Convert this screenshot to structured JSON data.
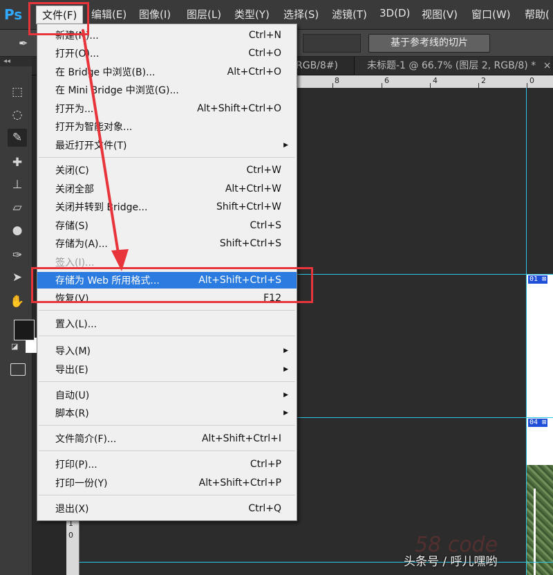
{
  "app": {
    "logo": "Ps",
    "menubar": [
      {
        "label": "文件(F)"
      },
      {
        "label": "编辑(E)"
      },
      {
        "label": "图像(I)"
      },
      {
        "label": "图层(L)"
      },
      {
        "label": "类型(Y)"
      },
      {
        "label": "选择(S)"
      },
      {
        "label": "滤镜(T)"
      },
      {
        "label": "3D(D)"
      },
      {
        "label": "视图(V)"
      },
      {
        "label": "窗口(W)"
      },
      {
        "label": "帮助("
      }
    ]
  },
  "options_bar": {
    "slice_button": "基于参考线的切片"
  },
  "toolbar": {
    "collapse": "◂◂",
    "tools": [
      {
        "icon": "marquee-icon"
      },
      {
        "icon": "lasso-icon"
      },
      {
        "icon": "slice-tool-icon"
      },
      {
        "icon": "healing-brush-icon"
      },
      {
        "icon": "clone-stamp-icon"
      },
      {
        "icon": "eraser-icon"
      },
      {
        "icon": "blur-icon"
      },
      {
        "icon": "pen-icon"
      },
      {
        "icon": "path-selection-icon"
      },
      {
        "icon": "hand-icon"
      }
    ],
    "foreground_color": "#1a1a1a",
    "background_color": "#ffffff"
  },
  "document": {
    "tabs": [
      {
        "label": "RGB/8#)"
      },
      {
        "label": "未标题-1 @ 66.7% (图层 2, RGB/8) *",
        "close": "×"
      }
    ],
    "ruler_top": [
      "8",
      "6",
      "4",
      "2",
      "0"
    ],
    "ruler_left": [
      "1",
      "0"
    ],
    "slices": [
      {
        "label": "01"
      },
      {
        "label": "04"
      }
    ]
  },
  "file_menu": {
    "groups": [
      [
        {
          "label": "新建(N)...",
          "shortcut": "Ctrl+N"
        },
        {
          "label": "打开(O)...",
          "shortcut": "Ctrl+O"
        },
        {
          "label": "在 Bridge 中浏览(B)...",
          "shortcut": "Alt+Ctrl+O"
        },
        {
          "label": "在 Mini Bridge 中浏览(G)...",
          "shortcut": ""
        },
        {
          "label": "打开为...",
          "shortcut": "Alt+Shift+Ctrl+O"
        },
        {
          "label": "打开为智能对象...",
          "shortcut": ""
        },
        {
          "label": "最近打开文件(T)",
          "shortcut": "",
          "submenu": true
        }
      ],
      [
        {
          "label": "关闭(C)",
          "shortcut": "Ctrl+W"
        },
        {
          "label": "关闭全部",
          "shortcut": "Alt+Ctrl+W"
        },
        {
          "label": "关闭并转到 Bridge...",
          "shortcut": "Shift+Ctrl+W"
        },
        {
          "label": "存储(S)",
          "shortcut": "Ctrl+S"
        },
        {
          "label": "存储为(A)...",
          "shortcut": "Shift+Ctrl+S"
        },
        {
          "label": "签入(I)...",
          "shortcut": "",
          "disabled": true
        },
        {
          "label": "存储为 Web 所用格式...",
          "shortcut": "Alt+Shift+Ctrl+S",
          "selected": true
        },
        {
          "label": "恢复(V)",
          "shortcut": "F12"
        }
      ],
      [
        {
          "label": "置入(L)...",
          "shortcut": ""
        }
      ],
      [
        {
          "label": "导入(M)",
          "shortcut": "",
          "submenu": true
        },
        {
          "label": "导出(E)",
          "shortcut": "",
          "submenu": true
        }
      ],
      [
        {
          "label": "自动(U)",
          "shortcut": "",
          "submenu": true
        },
        {
          "label": "脚本(R)",
          "shortcut": "",
          "submenu": true
        }
      ],
      [
        {
          "label": "文件简介(F)...",
          "shortcut": "Alt+Shift+Ctrl+I"
        }
      ],
      [
        {
          "label": "打印(P)...",
          "shortcut": "Ctrl+P"
        },
        {
          "label": "打印一份(Y)",
          "shortcut": "Alt+Shift+Ctrl+P"
        }
      ],
      [
        {
          "label": "退出(X)",
          "shortcut": "Ctrl+Q"
        }
      ]
    ]
  },
  "annotation": {
    "highlight_color": "#e8353b"
  },
  "watermark": "头条号 / 呼儿嘿哟"
}
